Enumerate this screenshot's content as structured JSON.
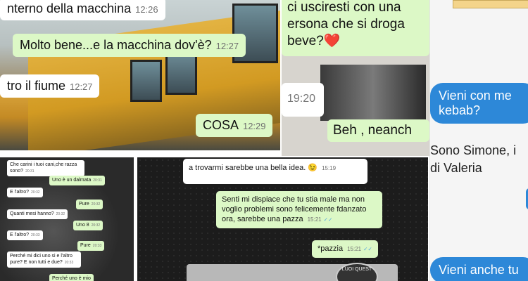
{
  "panel1": {
    "messages": [
      {
        "text": "nterno della macchina",
        "time": "12:26"
      },
      {
        "text": "Molto bene...e la macchina dov'è?",
        "time": "12:27"
      },
      {
        "text": "tro il fiume",
        "time": "12:27"
      },
      {
        "text": "COSA",
        "time": "12:29"
      }
    ]
  },
  "panel2": {
    "messages": [
      {
        "text": "ci usciresti con una"
      },
      {
        "text": "ersona che si droga"
      },
      {
        "text": "beve?❤️"
      },
      {
        "time": "19:20"
      },
      {
        "text": "Beh , neanch"
      }
    ]
  },
  "panel3": {
    "messages": [
      {
        "text": "Vieni con me kebab?"
      },
      {
        "text": "Sono Simone, i"
      },
      {
        "text": "di Valeria"
      },
      {
        "text": "Vieni anche tu"
      }
    ]
  },
  "panel4": {
    "messages": [
      {
        "text": "Che carini i tuoi cani,che razza sono?",
        "time": "20:31"
      },
      {
        "text": "Uno è un dalmata",
        "time": "20:31"
      },
      {
        "text": "E l'altro?",
        "time": "20:32"
      },
      {
        "text": "Pure",
        "time": "20:32"
      },
      {
        "text": "Quanti mesi hanno?",
        "time": "20:32"
      },
      {
        "text": "Uno 8",
        "time": "20:32"
      },
      {
        "text": "E l'altro?",
        "time": "20:33"
      },
      {
        "text": "Pure",
        "time": "20:33"
      },
      {
        "text": "Perché mi dici uno si e l'altro pure? E non tutti e due?",
        "time": "20:33"
      },
      {
        "text": "Perché uno è mio"
      }
    ]
  },
  "panel5": {
    "messages": [
      {
        "text": "a trovarmi sarebbe una bella idea. 😉",
        "time": "15:19"
      },
      {
        "text": "Senti mi dispiace che tu stia male ma non voglio problemi sono felicemente fdanzato ora, sarebbe una pazza",
        "time": "15:21"
      },
      {
        "text": "*pazzia",
        "time": "15:21"
      }
    ],
    "watermark": "LUOI QUEST"
  }
}
